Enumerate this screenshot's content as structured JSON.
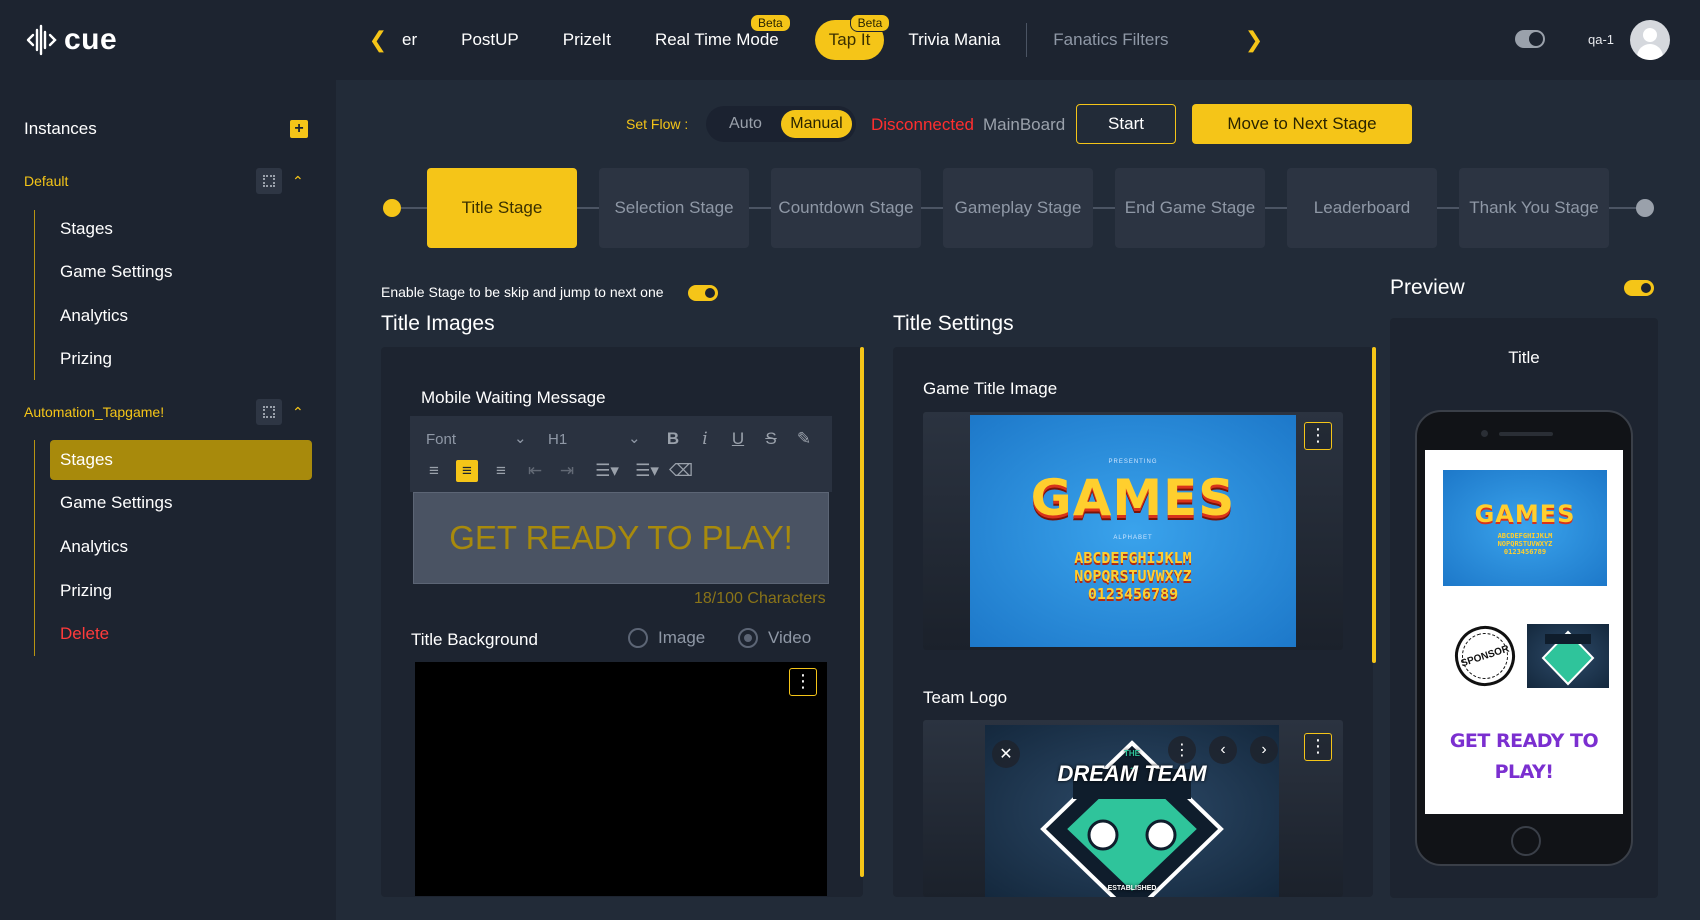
{
  "app": {
    "logo_text": "cue"
  },
  "game_tabs": [
    {
      "label": "er",
      "beta": ""
    },
    {
      "label": "PostUP",
      "beta": ""
    },
    {
      "label": "PrizeIt",
      "beta": ""
    },
    {
      "label": "Real Time Mode",
      "beta": "Beta"
    },
    {
      "label": "Tap It",
      "beta": "Beta"
    },
    {
      "label": "Trivia Mania",
      "beta": ""
    },
    {
      "label": "Fanatics Filters",
      "beta": ""
    }
  ],
  "user": {
    "name": "qa-1"
  },
  "sidebar": {
    "title": "Instances",
    "instances": [
      {
        "name": "Default",
        "items": [
          "Stages",
          "Game Settings",
          "Analytics",
          "Prizing"
        ]
      },
      {
        "name": "Automation_Tapgame!",
        "items": [
          "Stages",
          "Game Settings",
          "Analytics",
          "Prizing",
          "Delete"
        ]
      }
    ]
  },
  "flow": {
    "label": "Set Flow :",
    "options": [
      "Auto",
      "Manual"
    ],
    "selected": "Manual",
    "status": "Disconnected",
    "board": "MainBoard",
    "start_label": "Start",
    "next_label": "Move to Next Stage"
  },
  "stages": [
    "Title Stage",
    "Selection Stage",
    "Countdown Stage",
    "Gameplay Stage",
    "End Game Stage",
    "Leaderboard",
    "Thank You Stage"
  ],
  "skip_text": "Enable Stage to be skip and jump to next one",
  "title_images": {
    "heading": "Title Images",
    "editor_label": "Mobile Waiting Message",
    "font_placeholder": "Font",
    "heading_level": "H1",
    "message": "GET READY TO PLAY!",
    "char_count": "18/100 Characters",
    "bg_label": "Title Background",
    "bg_options": [
      "Image",
      "Video"
    ],
    "bg_selected": "Video"
  },
  "title_settings": {
    "heading": "Title Settings",
    "game_title_image_label": "Game Title Image",
    "team_logo_label": "Team Logo"
  },
  "games_art": {
    "presenting": "PRESENTING",
    "word": "GAMES",
    "alphabet": "ALPHABET",
    "line1": "ABCDEFGHIJKLM",
    "line2": "NOPQRSTUVWXYZ",
    "line3": "0123456789"
  },
  "team_art": {
    "the": "THE",
    "word": "DREAM TEAM",
    "established": "ESTABLISHED"
  },
  "preview": {
    "title": "Preview",
    "screen_title": "Title",
    "sponsor": "SPONSOR",
    "ready_line1": "GET READY TO",
    "ready_line2": "PLAY!"
  },
  "colors": {
    "accent": "#f5c518",
    "danger": "#ff2e2e",
    "bg": "#222b38",
    "panel": "#1d2430",
    "preview_text": "#7b2fd0"
  }
}
